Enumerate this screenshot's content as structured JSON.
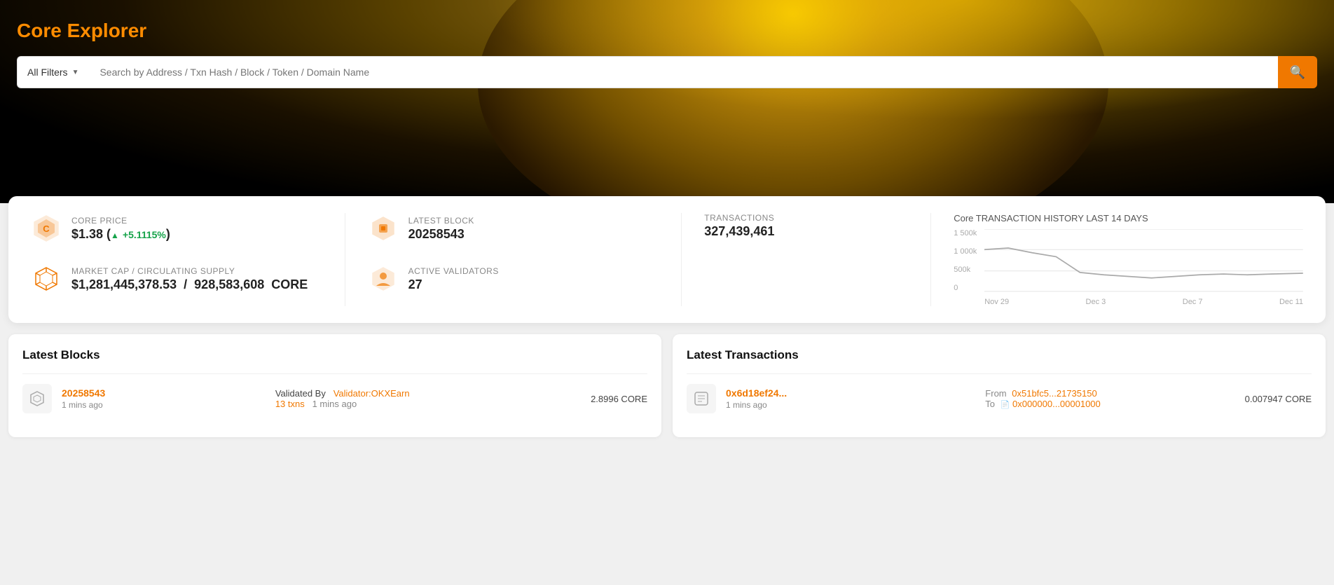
{
  "hero": {
    "title": "Core Explorer",
    "search_placeholder": "Search by Address / Txn Hash / Block / Token / Domain Name",
    "filter_label": "All Filters"
  },
  "stats": {
    "price_label": "CORE PRICE",
    "price_value": "$1.38",
    "price_arrow": "▲",
    "price_change": "+5.1115%",
    "latest_block_label": "LATEST BLOCK",
    "latest_block_value": "20258543",
    "transactions_label": "TRANSACTIONS",
    "transactions_value": "327,439,461",
    "market_cap_label": "MARKET CAP / CIRCULATING SUPPLY",
    "market_cap_value": "$1,281,445,378.53",
    "circulating_supply": "928,583,608",
    "supply_unit": "CORE",
    "active_validators_label": "ACTIVE VALIDATORS",
    "active_validators_value": "27",
    "chart_title": "Core TRANSACTION HISTORY LAST 14 DAYS",
    "chart_y_labels": [
      "1 500k",
      "1 000k",
      "500k",
      "0"
    ],
    "chart_x_labels": [
      "Nov 29",
      "Dec 3",
      "Dec 7",
      "Dec 11"
    ]
  },
  "latest_blocks": {
    "section_title": "Latest Blocks",
    "blocks": [
      {
        "number": "20258543",
        "time": "1 mins ago",
        "validated_by_label": "Validated By",
        "validator": "Validator:OKXEarn",
        "txns_count": "13 txns",
        "txns_time": "1 mins ago",
        "reward": "2.8996 CORE"
      }
    ]
  },
  "latest_transactions": {
    "section_title": "Latest Transactions",
    "transactions": [
      {
        "hash": "0x6d18ef24...",
        "time": "1 mins ago",
        "from_label": "From",
        "from_addr": "0x51bfc5...21735150",
        "to_label": "To",
        "to_addr": "0x000000...00001000",
        "value": "0.007947 CORE"
      }
    ]
  }
}
